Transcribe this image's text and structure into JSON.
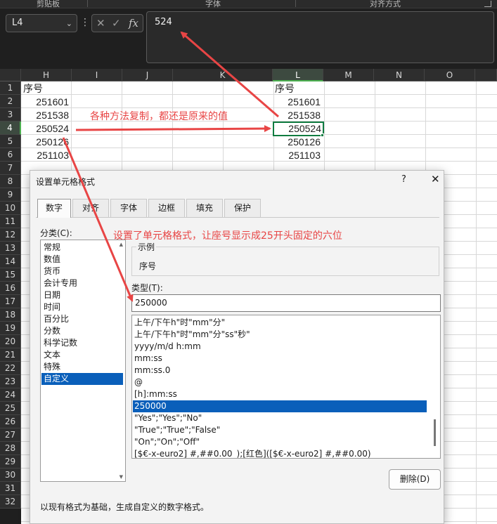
{
  "ribbon": {
    "groups": [
      "剪贴板",
      "字体",
      "对齐方式"
    ]
  },
  "formula_bar": {
    "name_box": "L4",
    "cancel_icon": "✕",
    "enter_icon": "✓",
    "fx_icon": "fx",
    "content": "524"
  },
  "grid": {
    "columns": [
      "H",
      "I",
      "J",
      "K",
      "L",
      "M",
      "N",
      "O"
    ],
    "selected_column": "L",
    "rows": [
      "1",
      "2",
      "3",
      "4",
      "5",
      "6",
      "7",
      "8",
      "9",
      "10",
      "11",
      "12",
      "13",
      "14",
      "15",
      "16",
      "17",
      "18",
      "19",
      "20",
      "21",
      "22",
      "23",
      "24",
      "25",
      "26",
      "27",
      "28",
      "29",
      "30",
      "31",
      "32"
    ],
    "selected_row": "4",
    "col_h": [
      "序号",
      "251601",
      "251538",
      "250524",
      "250126",
      "251103"
    ],
    "col_l": [
      "序号",
      "251601",
      "251538",
      "250524",
      "250126",
      "251103"
    ]
  },
  "annotations": {
    "copy_note": "各种方法复制，都还是原来的值",
    "format_note": "设置了单元格格式，让座号显示成25开头固定的六位"
  },
  "dialog": {
    "title": "设置单元格格式",
    "help": "?",
    "close": "✕",
    "tabs": [
      "数字",
      "对齐",
      "字体",
      "边框",
      "填充",
      "保护"
    ],
    "active_tab": "数字",
    "category_label": "分类(C):",
    "categories": [
      "常规",
      "数值",
      "货币",
      "会计专用",
      "日期",
      "时间",
      "百分比",
      "分数",
      "科学记数",
      "文本",
      "特殊",
      "自定义"
    ],
    "selected_category": "自定义",
    "sample_label": "示例",
    "sample_value": "序号",
    "type_label": "类型(T):",
    "type_value": "250000",
    "formats": [
      "上午/下午h\"时\"mm\"分\"",
      "上午/下午h\"时\"mm\"分\"ss\"秒\"",
      "yyyy/m/d h:mm",
      "mm:ss",
      "mm:ss.0",
      "@",
      "[h]:mm:ss",
      "250000",
      "\"Yes\";\"Yes\";\"No\"",
      "\"True\";\"True\";\"False\"",
      "\"On\";\"On\";\"Off\"",
      "[$€-x-euro2] #,##0.00_);[红色]([$€-x-euro2] #,##0.00)"
    ],
    "selected_format": "250000",
    "delete_button": "删除(D)",
    "hint": "以现有格式为基础，生成自定义的数字格式。"
  },
  "colors": {
    "annotation": "#e84545",
    "selection": "#0a5fba",
    "excel_green": "#107c41"
  }
}
